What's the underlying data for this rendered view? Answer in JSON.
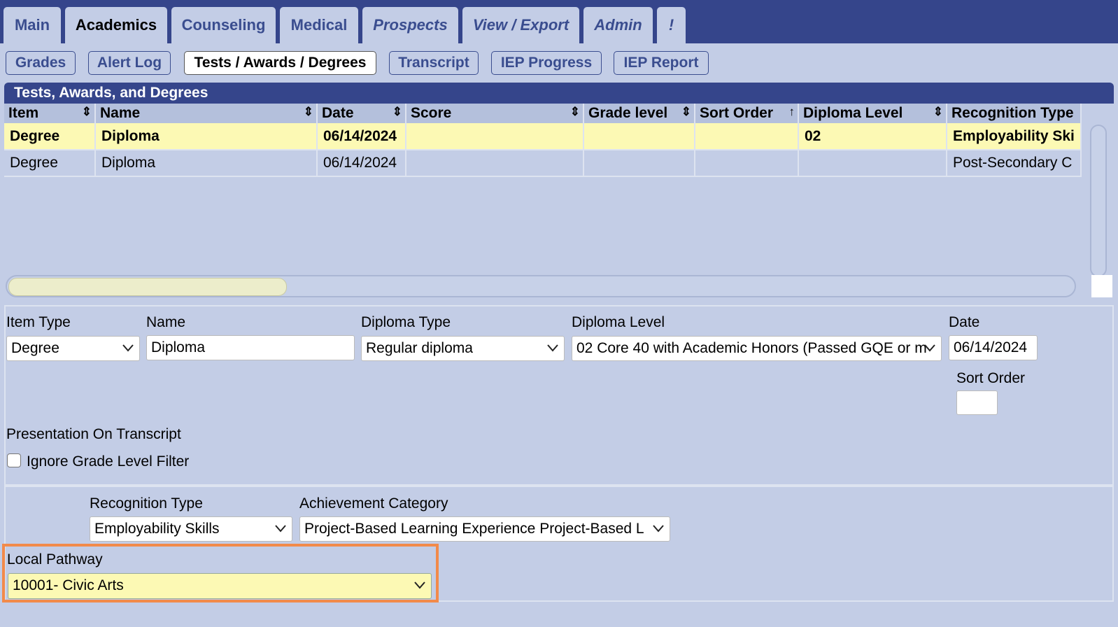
{
  "tabs": [
    "Main",
    "Academics",
    "Counseling",
    "Medical",
    "Prospects",
    "View / Export",
    "Admin",
    "!"
  ],
  "subtabs": [
    "Grades",
    "Alert Log",
    "Tests / Awards / Degrees",
    "Transcript",
    "IEP Progress",
    "IEP Report"
  ],
  "panel_title": "Tests, Awards, and Degrees",
  "grid": {
    "columns": [
      "Item",
      "Name",
      "Date",
      "Score",
      "Grade level",
      "Sort Order",
      "Diploma Level",
      "Recognition Type"
    ],
    "sort_icons": [
      "⇕",
      "⇕",
      "⇕",
      "⇕",
      "⇕",
      "↑",
      "⇕",
      ""
    ],
    "rows": [
      {
        "item": "Degree",
        "name": "Diploma",
        "date": "06/14/2024",
        "score": "",
        "grade_level": "",
        "sort_order": "",
        "diploma_level": "02",
        "recognition_type": "Employability Ski"
      },
      {
        "item": "Degree",
        "name": "Diploma",
        "date": "06/14/2024",
        "score": "",
        "grade_level": "",
        "sort_order": "",
        "diploma_level": "",
        "recognition_type": "Post-Secondary C"
      }
    ]
  },
  "form": {
    "item_type_label": "Item Type",
    "item_type_value": "Degree",
    "name_label": "Name",
    "name_value": "Diploma",
    "diploma_type_label": "Diploma Type",
    "diploma_type_value": "Regular diploma",
    "diploma_level_label": "Diploma Level",
    "diploma_level_value": "02 Core 40 with Academic Honors (Passed GQE or m",
    "date_label": "Date",
    "date_value": "06/14/2024",
    "sort_order_label": "Sort Order",
    "sort_order_value": "",
    "presentation_label": "Presentation On Transcript",
    "ignore_filter_label": "Ignore Grade Level Filter",
    "recognition_type_label": "Recognition Type",
    "recognition_type_value": "Employability Skills",
    "achievement_category_label": "Achievement Category",
    "achievement_category_value": "Project-Based Learning Experience Project-Based L",
    "local_pathway_label": "Local Pathway",
    "local_pathway_value": "10001- Civic Arts"
  },
  "colors": {
    "header": "#35458b",
    "background": "#c3cde6",
    "selected_row": "#fcf9b4",
    "highlight": "#f28a4a"
  }
}
